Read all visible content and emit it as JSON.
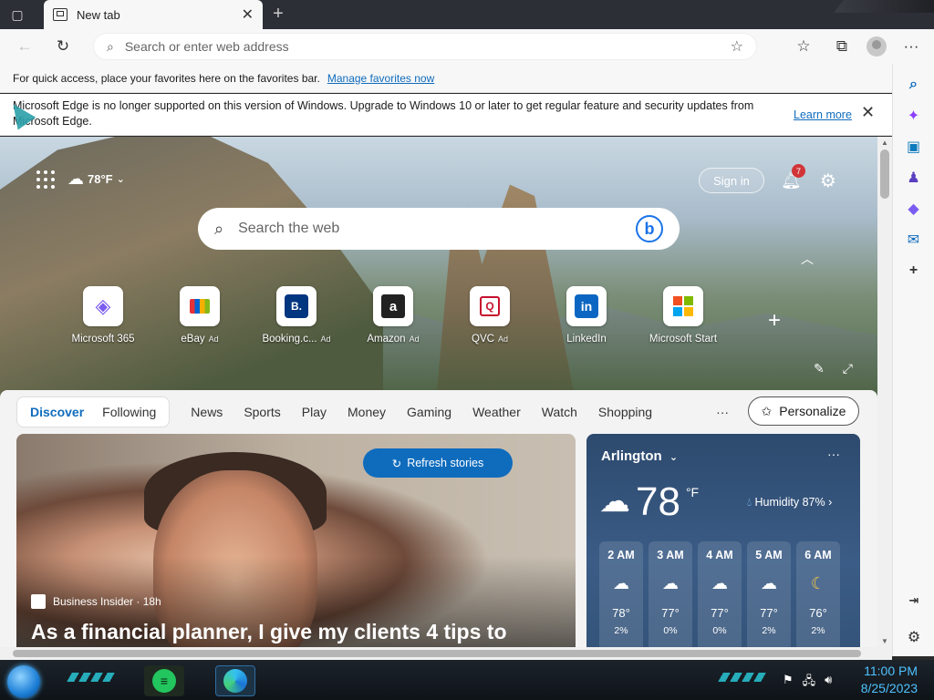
{
  "tab": {
    "title": "New tab"
  },
  "toolbar": {
    "address_placeholder": "Search or enter web address"
  },
  "favbar": {
    "text": "For quick access, place your favorites here on the favorites bar.",
    "link": "Manage favorites now"
  },
  "infobar": {
    "message": "Microsoft Edge is no longer supported on this version of Windows. Upgrade to Windows 10 or later to get regular feature and security updates from Microsoft Edge.",
    "learn_more": "Learn more"
  },
  "hero": {
    "weather_temp": "78°F",
    "signin": "Sign in",
    "notification_count": "7",
    "search_placeholder": "Search the web",
    "quicklinks": [
      {
        "label": "Microsoft 365",
        "ad": ""
      },
      {
        "label": "eBay",
        "ad": "Ad"
      },
      {
        "label": "Booking.c...",
        "ad": "Ad"
      },
      {
        "label": "Amazon",
        "ad": "Ad"
      },
      {
        "label": "QVC",
        "ad": "Ad"
      },
      {
        "label": "LinkedIn",
        "ad": ""
      },
      {
        "label": "Microsoft Start",
        "ad": ""
      }
    ]
  },
  "feed": {
    "tabs": {
      "discover": "Discover",
      "following": "Following"
    },
    "nav": [
      "News",
      "Sports",
      "Play",
      "Money",
      "Gaming",
      "Weather",
      "Watch",
      "Shopping"
    ],
    "more": "···",
    "personalize": "Personalize",
    "story": {
      "refresh": "Refresh stories",
      "source": "Business Insider · 18h",
      "headline": "As a financial planner, I give my clients 4 tips to"
    }
  },
  "weather": {
    "city": "Arlington",
    "temp": "78",
    "unit": "°F",
    "humidity": "Humidity 87%",
    "hours": [
      {
        "time": "2 AM",
        "temp": "78°",
        "precip": "2%"
      },
      {
        "time": "3 AM",
        "temp": "77°",
        "precip": "0%"
      },
      {
        "time": "4 AM",
        "temp": "77°",
        "precip": "0%"
      },
      {
        "time": "5 AM",
        "temp": "77°",
        "precip": "2%"
      },
      {
        "time": "6 AM",
        "temp": "76°",
        "precip": "2%"
      }
    ]
  },
  "taskbar": {
    "time": "11:00 PM",
    "date": "8/25/2023"
  },
  "colors": {
    "accent": "#0f6cbd",
    "badge": "#d13438",
    "clock": "#4fc3ff"
  }
}
